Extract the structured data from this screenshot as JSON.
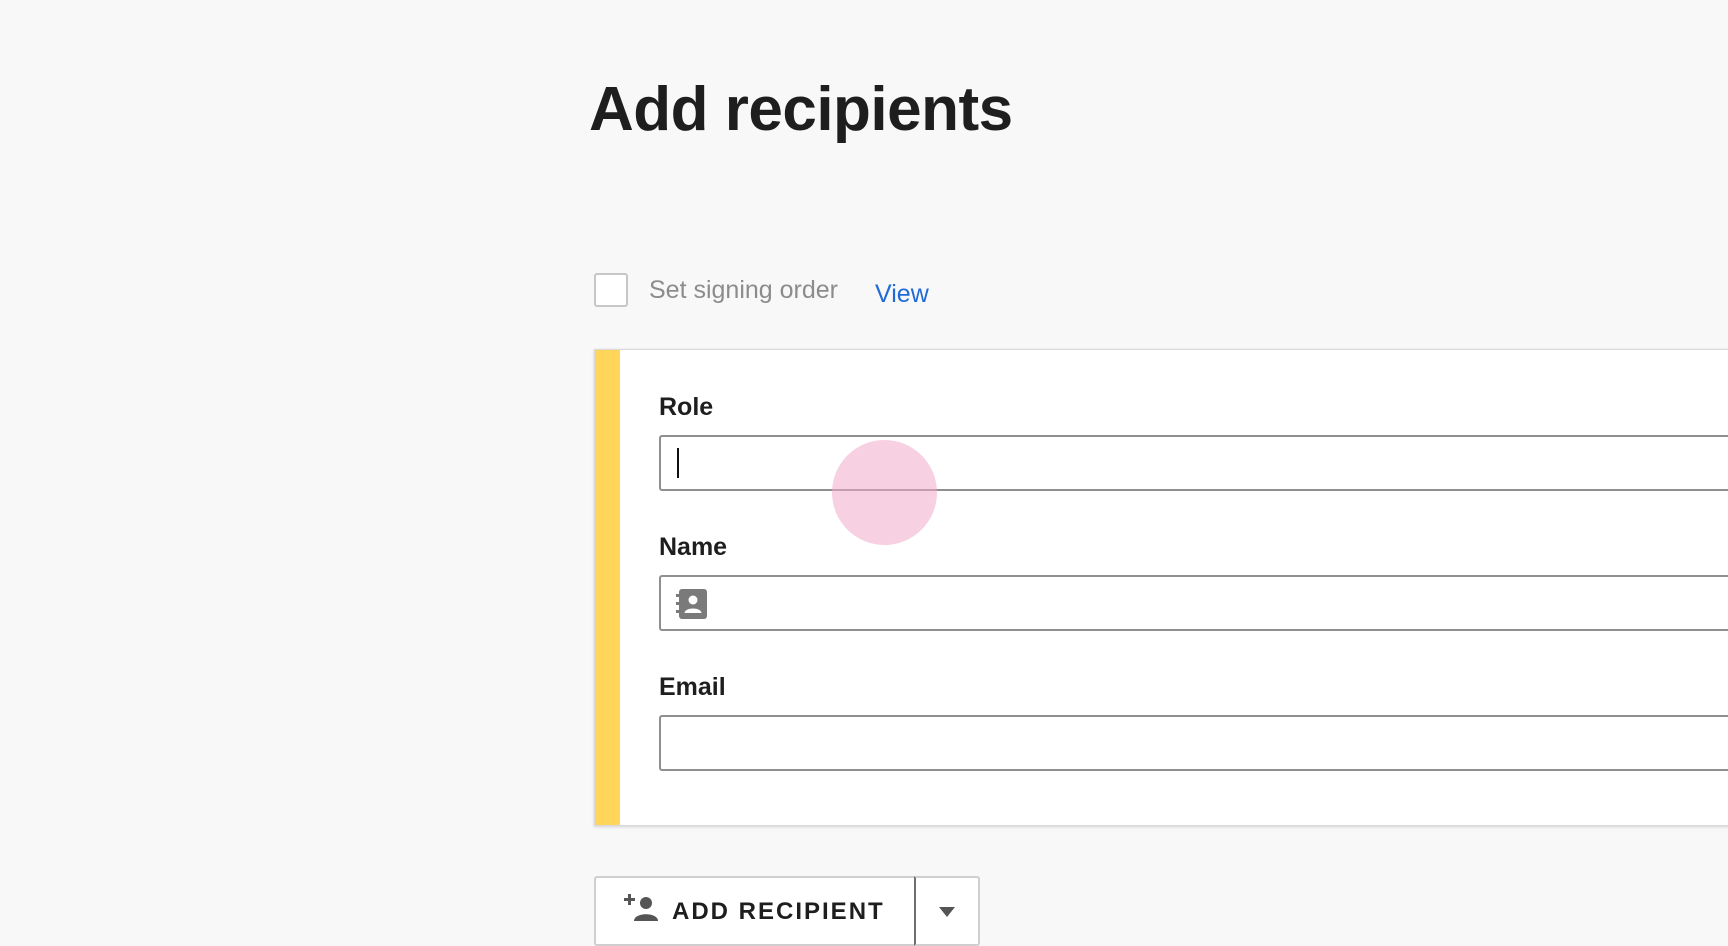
{
  "header": {
    "title": "Add recipients"
  },
  "signing_order": {
    "checkbox_checked": false,
    "label": "Set signing order",
    "view_link": "View"
  },
  "recipient": {
    "accent_color": "#ffd55a",
    "role": {
      "label": "Role",
      "value": ""
    },
    "name": {
      "label": "Name",
      "value": "",
      "icon": "contact-card-icon"
    },
    "email": {
      "label": "Email",
      "value": ""
    }
  },
  "actions": {
    "add_recipient_label": "ADD RECIPIENT",
    "add_recipient_icon": "add-person-icon",
    "dropdown_icon": "caret-down-icon"
  }
}
